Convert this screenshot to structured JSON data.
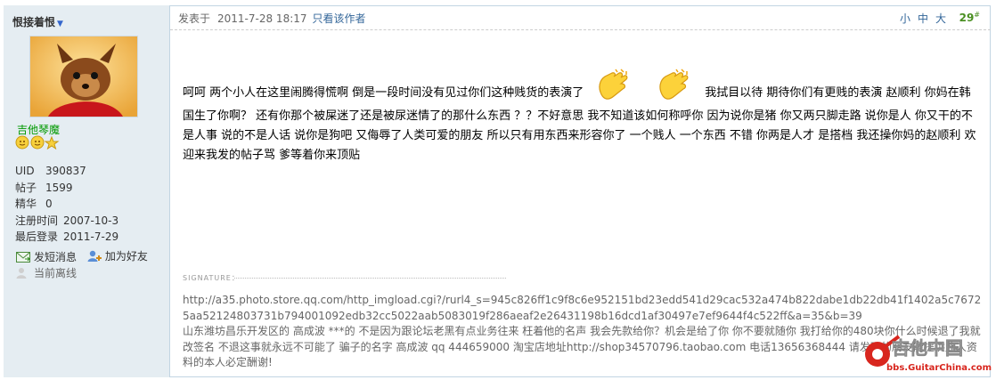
{
  "author": {
    "name": "恨接着恨",
    "group": "吉他琴魔",
    "stats": [
      {
        "label": "UID",
        "value": "390837"
      },
      {
        "label": "帖子",
        "value": "1599"
      },
      {
        "label": "精华",
        "value": "0"
      },
      {
        "label": "注册时间",
        "value": "2007-10-3"
      },
      {
        "label": "最后登录",
        "value": "2011-7-29"
      }
    ],
    "actions": {
      "pm": "发短消息",
      "add_friend": "加为好友"
    },
    "status": "当前离线"
  },
  "post_header": {
    "posted_label": "发表于",
    "posted_time": "2011-7-28 18:17",
    "only_author": "只看该作者",
    "font_small": "小",
    "font_medium": "中",
    "font_large": "大",
    "floor": "29",
    "floor_mark": "#"
  },
  "post": {
    "text_before": "呵呵  两个小人在这里闹腾得慌啊    倒是一段时间没有见过你们这种贱货的表演了",
    "text_after": "我拭目以待  期待你们有更贱的表演    赵顺利  你妈在韩国生了你啊？    还有你那个被屎迷了还是被尿迷情了的那什么东西  ？？不好意思  我不知道该如何称呼你  因为说你是猪    你又两只脚走路  说你是人  你又干的不是人事  说的不是人话  说你是狗吧    又侮辱了人类可爱的朋友  所以只有用东西来形容你了    一个贱人  一个东西    不错  你两是人才  是搭档    我还操你妈的赵顺利  欢迎来我发的帖子骂    爹等着你来顶贴"
  },
  "signature": {
    "label": "SIGNATURE：",
    "url": "http://a35.photo.store.qq.com/http_imgload.cgi?/rurl4_s=945c826ff1c9f8c6e952151bd23edd541d29cac532a474b822dabe1db22db41f1402a5c76725aa52124803731b794001092edb32cc5022aab5083019f286aeaf2e26431198b16dcd1af30497e7ef9644f4c522ff&a=35&b=39",
    "text": "山东潍坊昌乐开发区的  高成波  ***的    不是因为跟论坛老黑有点业务往来  枉着他的名声  我会先款给你？机会是给了你  你不要就随你  我打给你的480块你什么时候退了我就改签名  不退这事就永远不可能了  骗子的名字  高成波  qq   444659000  淘宝店地址http://shop34570796.taobao.com   电话13656368444 请发现的朋友能提供此人资料的本人必定酬谢!"
  },
  "watermark": {
    "brand": "吉他中国",
    "url": "bbs.GuitarChina.com"
  },
  "colors": {
    "sidebar_bg": "#e5edf2",
    "border": "#c2d5e3",
    "link": "#336699",
    "group": "#009900",
    "floor": "#4a8f22"
  }
}
